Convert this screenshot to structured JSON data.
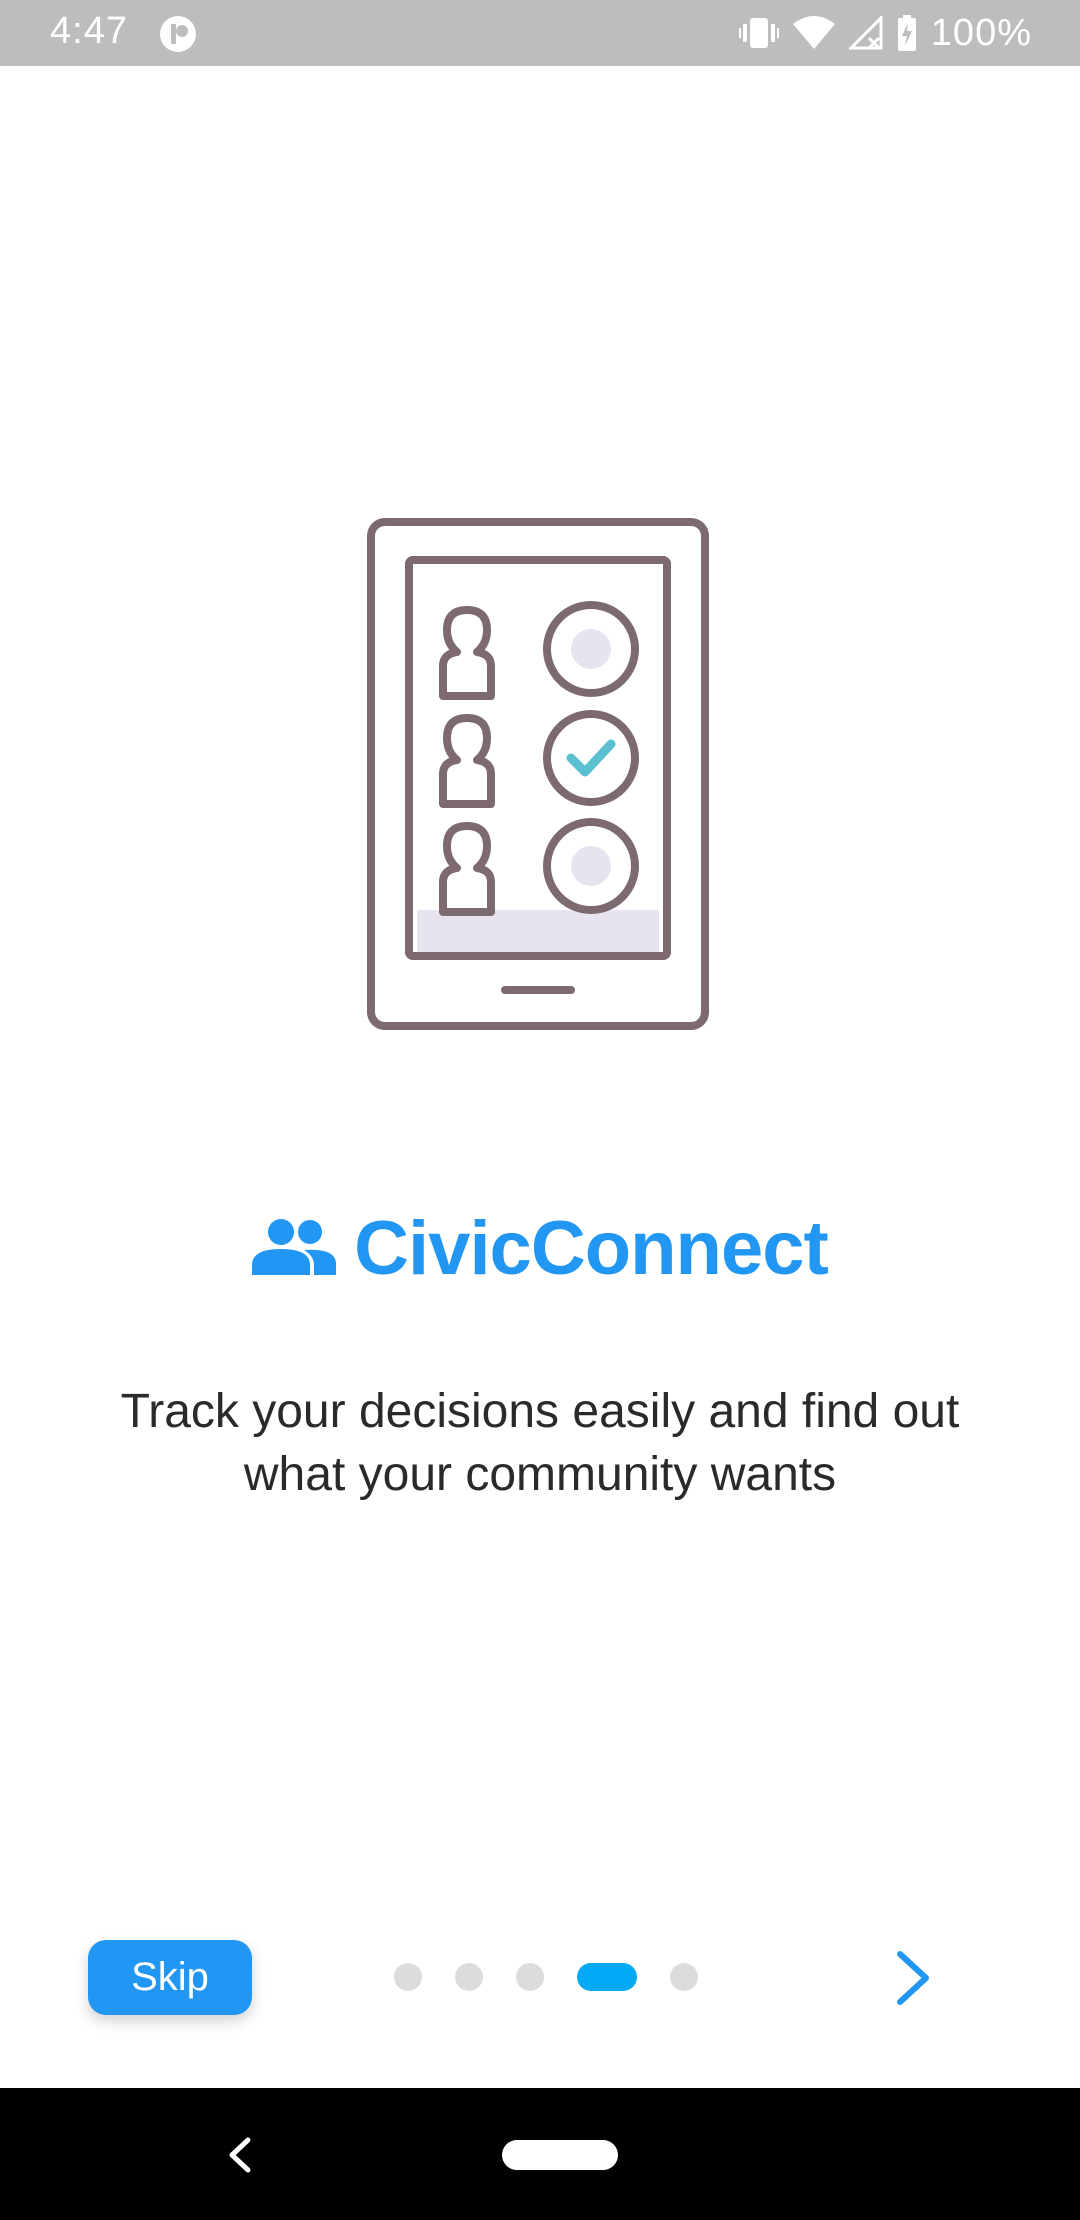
{
  "status_bar": {
    "time": "4:47",
    "battery": "100%",
    "icons": [
      "app-notification-icon",
      "vibrate-icon",
      "wifi-icon",
      "cellular-no-signal-icon",
      "battery-charging-icon"
    ]
  },
  "onboarding": {
    "illustration": "tablet-voting-checklist-illustration",
    "brand_icon": "people-icon",
    "brand_name": "CivicConnect",
    "description": "Track your decisions easily and find out what your community wants"
  },
  "controls": {
    "skip_label": "Skip",
    "next_icon": "chevron-right-icon",
    "pager_total": 5,
    "pager_current": 4
  },
  "nav_bar": {
    "icons": [
      "back-icon",
      "home-pill-icon"
    ]
  },
  "colors": {
    "accent": "#2196f3",
    "pager_active": "#03a9f4",
    "status_bar_bg": "#bdbdbd",
    "illustration_stroke": "#7d6a70",
    "illustration_check": "#5bc0d0",
    "illustration_fill": "#e7e3ef"
  }
}
